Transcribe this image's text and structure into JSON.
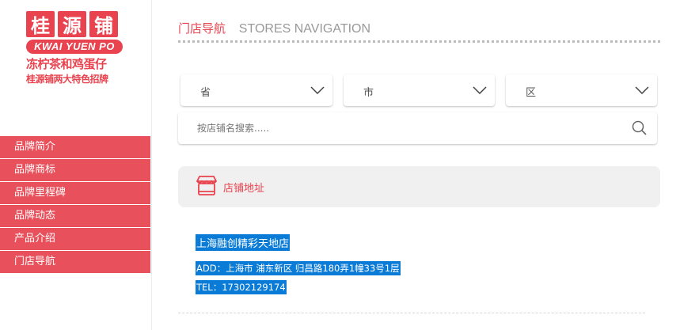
{
  "brand": {
    "chars": [
      "桂",
      "源",
      "铺"
    ],
    "en": "KWAI YUEN PO",
    "tagline1": "冻柠茶和鸡蛋仔",
    "tagline2": "桂源铺两大特色招牌",
    "color": "#e8434f"
  },
  "sidebar": {
    "items": [
      {
        "label": "品牌简介"
      },
      {
        "label": "品牌商标"
      },
      {
        "label": "品牌里程碑"
      },
      {
        "label": "品牌动态"
      },
      {
        "label": "产品介绍"
      },
      {
        "label": "门店导航"
      }
    ]
  },
  "header": {
    "title_cn": "门店导航",
    "title_en": "STORES NAVIGATION"
  },
  "filters": {
    "province": "省",
    "city": "市",
    "district": "区",
    "chevron_icon": "chevron-down-icon"
  },
  "search": {
    "placeholder": "按店铺名搜索.....",
    "icon": "search-icon"
  },
  "address_section": {
    "label": "店铺地址",
    "icon": "shop-icon"
  },
  "stores": [
    {
      "name": "上海融创精彩天地店",
      "address": "ADD：上海市  浦东新区 归昌路180弄1幢33号1层",
      "tel": "TEL：17302129174"
    }
  ]
}
